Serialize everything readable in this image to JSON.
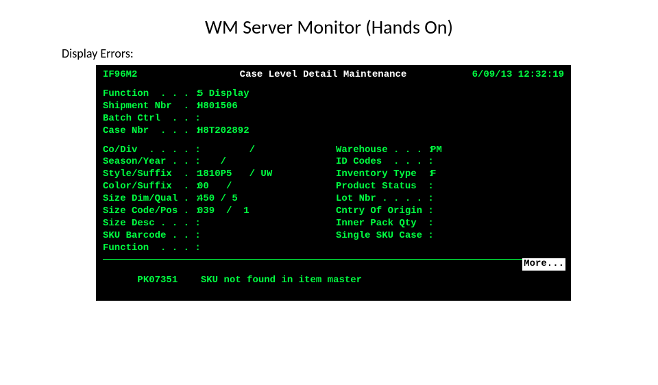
{
  "title": "WM Server Monitor (Hands On)",
  "subheading": "Display Errors:",
  "terminal": {
    "screen_id": "IF96M2",
    "screen_title": "Case Level Detail Maintenance",
    "timestamp": "6/09/13 12:32:19",
    "top_fields": [
      {
        "label": "Function  . . . :",
        "value": "5 Display"
      },
      {
        "label": "Shipment Nbr  . :",
        "value": "H801506"
      },
      {
        "label": "Batch Ctrl  . . :",
        "value": ""
      },
      {
        "label": "Case Nbr  . . . :",
        "value": "H8T202892"
      }
    ],
    "left_fields": [
      {
        "label": "Co/Div  . . . . :",
        "value": "         /"
      },
      {
        "label": "Season/Year . . :",
        "value": "    /"
      },
      {
        "label": "Style/Suffix  . :",
        "value": "1810P5   / UW"
      },
      {
        "label": "Color/Suffix  . :",
        "value": "00   /"
      },
      {
        "label": "Size Dim/Qual . :",
        "value": "450 / 5"
      },
      {
        "label": "Size Code/Pos . :",
        "value": "039  /  1"
      },
      {
        "label": "Size Desc . . . :",
        "value": ""
      },
      {
        "label": "SKU Barcode . . :",
        "value": ""
      },
      {
        "label": "Function  . . . :",
        "value": ""
      }
    ],
    "right_fields": [
      {
        "label": "Warehouse . . . :",
        "value": "PM"
      },
      {
        "label": "ID Codes  . . . :",
        "value": ""
      },
      {
        "label": "Inventory Type  :",
        "value": "F"
      },
      {
        "label": "Product Status  :",
        "value": ""
      },
      {
        "label": "Lot Nbr . . . . :",
        "value": ""
      },
      {
        "label": "Cntry Of Origin :",
        "value": ""
      },
      {
        "label": "Inner Pack Qty  :",
        "value": ""
      },
      {
        "label": "Single SKU Case :",
        "value": ""
      }
    ],
    "more_label": "More...",
    "status_code": "PK07351",
    "status_text": "SKU not found in item master"
  }
}
